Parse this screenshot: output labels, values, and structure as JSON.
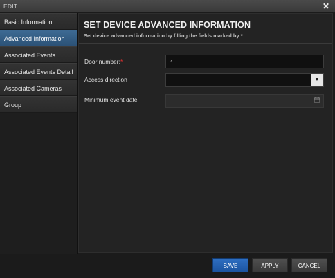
{
  "window": {
    "title": "EDIT",
    "close_glyph": "✕"
  },
  "sidebar": {
    "items": [
      {
        "label": "Basic Information",
        "active": false
      },
      {
        "label": "Advanced Information",
        "active": true
      },
      {
        "label": "Associated Events",
        "active": false
      },
      {
        "label": "Associated Events Detail",
        "active": false
      },
      {
        "label": "Associated Cameras",
        "active": false
      },
      {
        "label": "Group",
        "active": false
      }
    ]
  },
  "main": {
    "heading": "SET DEVICE ADVANCED INFORMATION",
    "subheading": "Set device advanced information by filling the fields marked by *",
    "fields": {
      "door_number": {
        "label": "Door number:",
        "required_mark": "*",
        "value": "1"
      },
      "access_direction": {
        "label": "Access direction",
        "value": ""
      },
      "minimum_event_date": {
        "label": "Minimum event date",
        "value": ""
      }
    }
  },
  "footer": {
    "save_label": "SAVE",
    "apply_label": "APPLY",
    "cancel_label": "CANCEL"
  },
  "colors": {
    "accent": "#2c5277",
    "save_button": "#1c54a0",
    "required": "#e03030"
  },
  "icons": {
    "close": "close-icon",
    "dropdown": "chevron-down-icon",
    "calendar": "calendar-icon"
  }
}
